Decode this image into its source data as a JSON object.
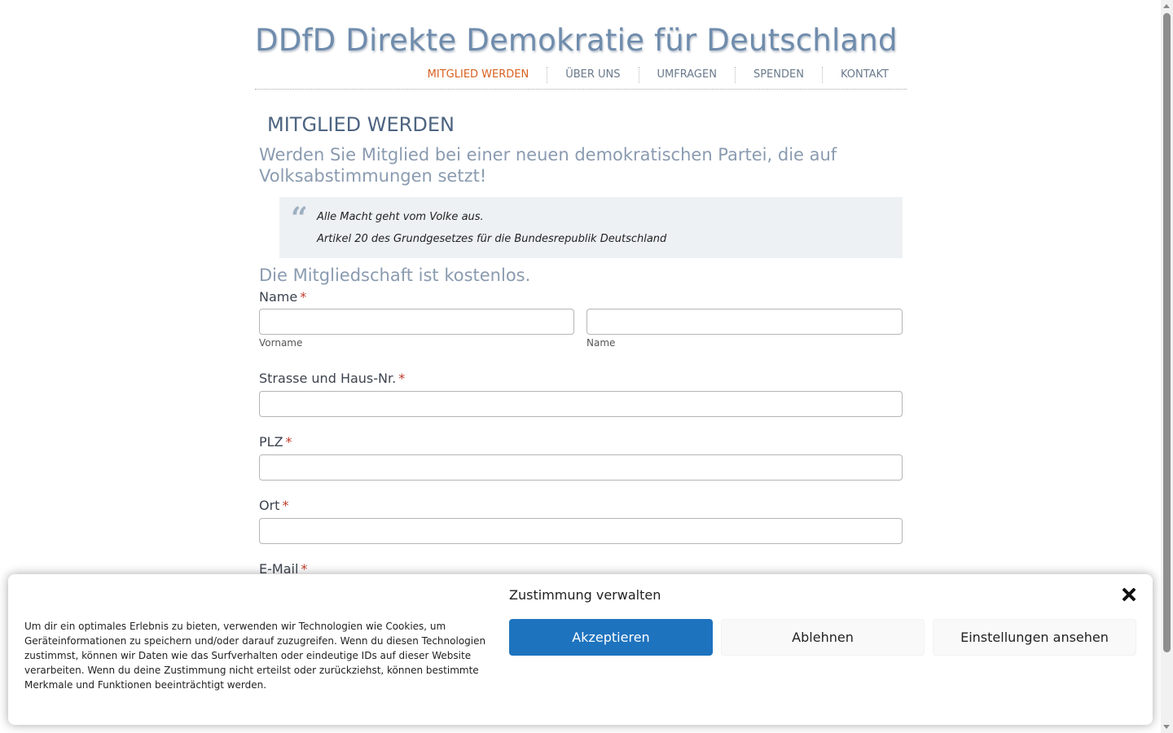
{
  "site": {
    "title": "DDfD Direkte Demokratie für Deutschland"
  },
  "nav": {
    "items": [
      {
        "label": "MITGLIED WERDEN",
        "active": true
      },
      {
        "label": "ÜBER UNS"
      },
      {
        "label": "UMFRAGEN"
      },
      {
        "label": "SPENDEN"
      },
      {
        "label": "KONTAKT"
      }
    ]
  },
  "main": {
    "heading": "MITGLIED WERDEN",
    "subtitle": "Werden Sie Mitglied bei einer neuen demokratischen Partei, die auf Volksabstimmungen setzt!",
    "quote": {
      "mark": "“",
      "text": "Alle Macht geht vom Volke aus.",
      "source": "Artikel 20 des Grundgesetzes für die Bundesrepublik Deutschland"
    },
    "free_note": "Die Mitgliedschaft ist kostenlos."
  },
  "form": {
    "required_marker": "*",
    "name": {
      "label": "Name",
      "first_sublabel": "Vorname",
      "last_sublabel": "Name",
      "first_value": "",
      "last_value": ""
    },
    "street": {
      "label": "Strasse und Haus-Nr.",
      "value": ""
    },
    "plz": {
      "label": "PLZ",
      "value": ""
    },
    "ort": {
      "label": "Ort",
      "value": ""
    },
    "email": {
      "label": "E-Mail"
    }
  },
  "cookie": {
    "title": "Zustimmung verwalten",
    "text": "Um dir ein optimales Erlebnis zu bieten, verwenden wir Technologien wie Cookies, um Geräteinformationen zu speichern und/oder darauf zuzugreifen. Wenn du diesen Technologien zustimmst, können wir Daten wie das Surfverhalten oder eindeutige IDs auf dieser Website verarbeiten. Wenn du deine Zustimmung nicht erteilst oder zurückziehst, können bestimmte Merkmale und Funktionen beeinträchtigt werden.",
    "accept_label": "Akzeptieren",
    "deny_label": "Ablehnen",
    "settings_label": "Einstellungen ansehen",
    "accent_color": "#1e73be"
  },
  "colors": {
    "nav_active": "#d9601f",
    "title": "#6f8cac",
    "required": "#c0392b"
  }
}
